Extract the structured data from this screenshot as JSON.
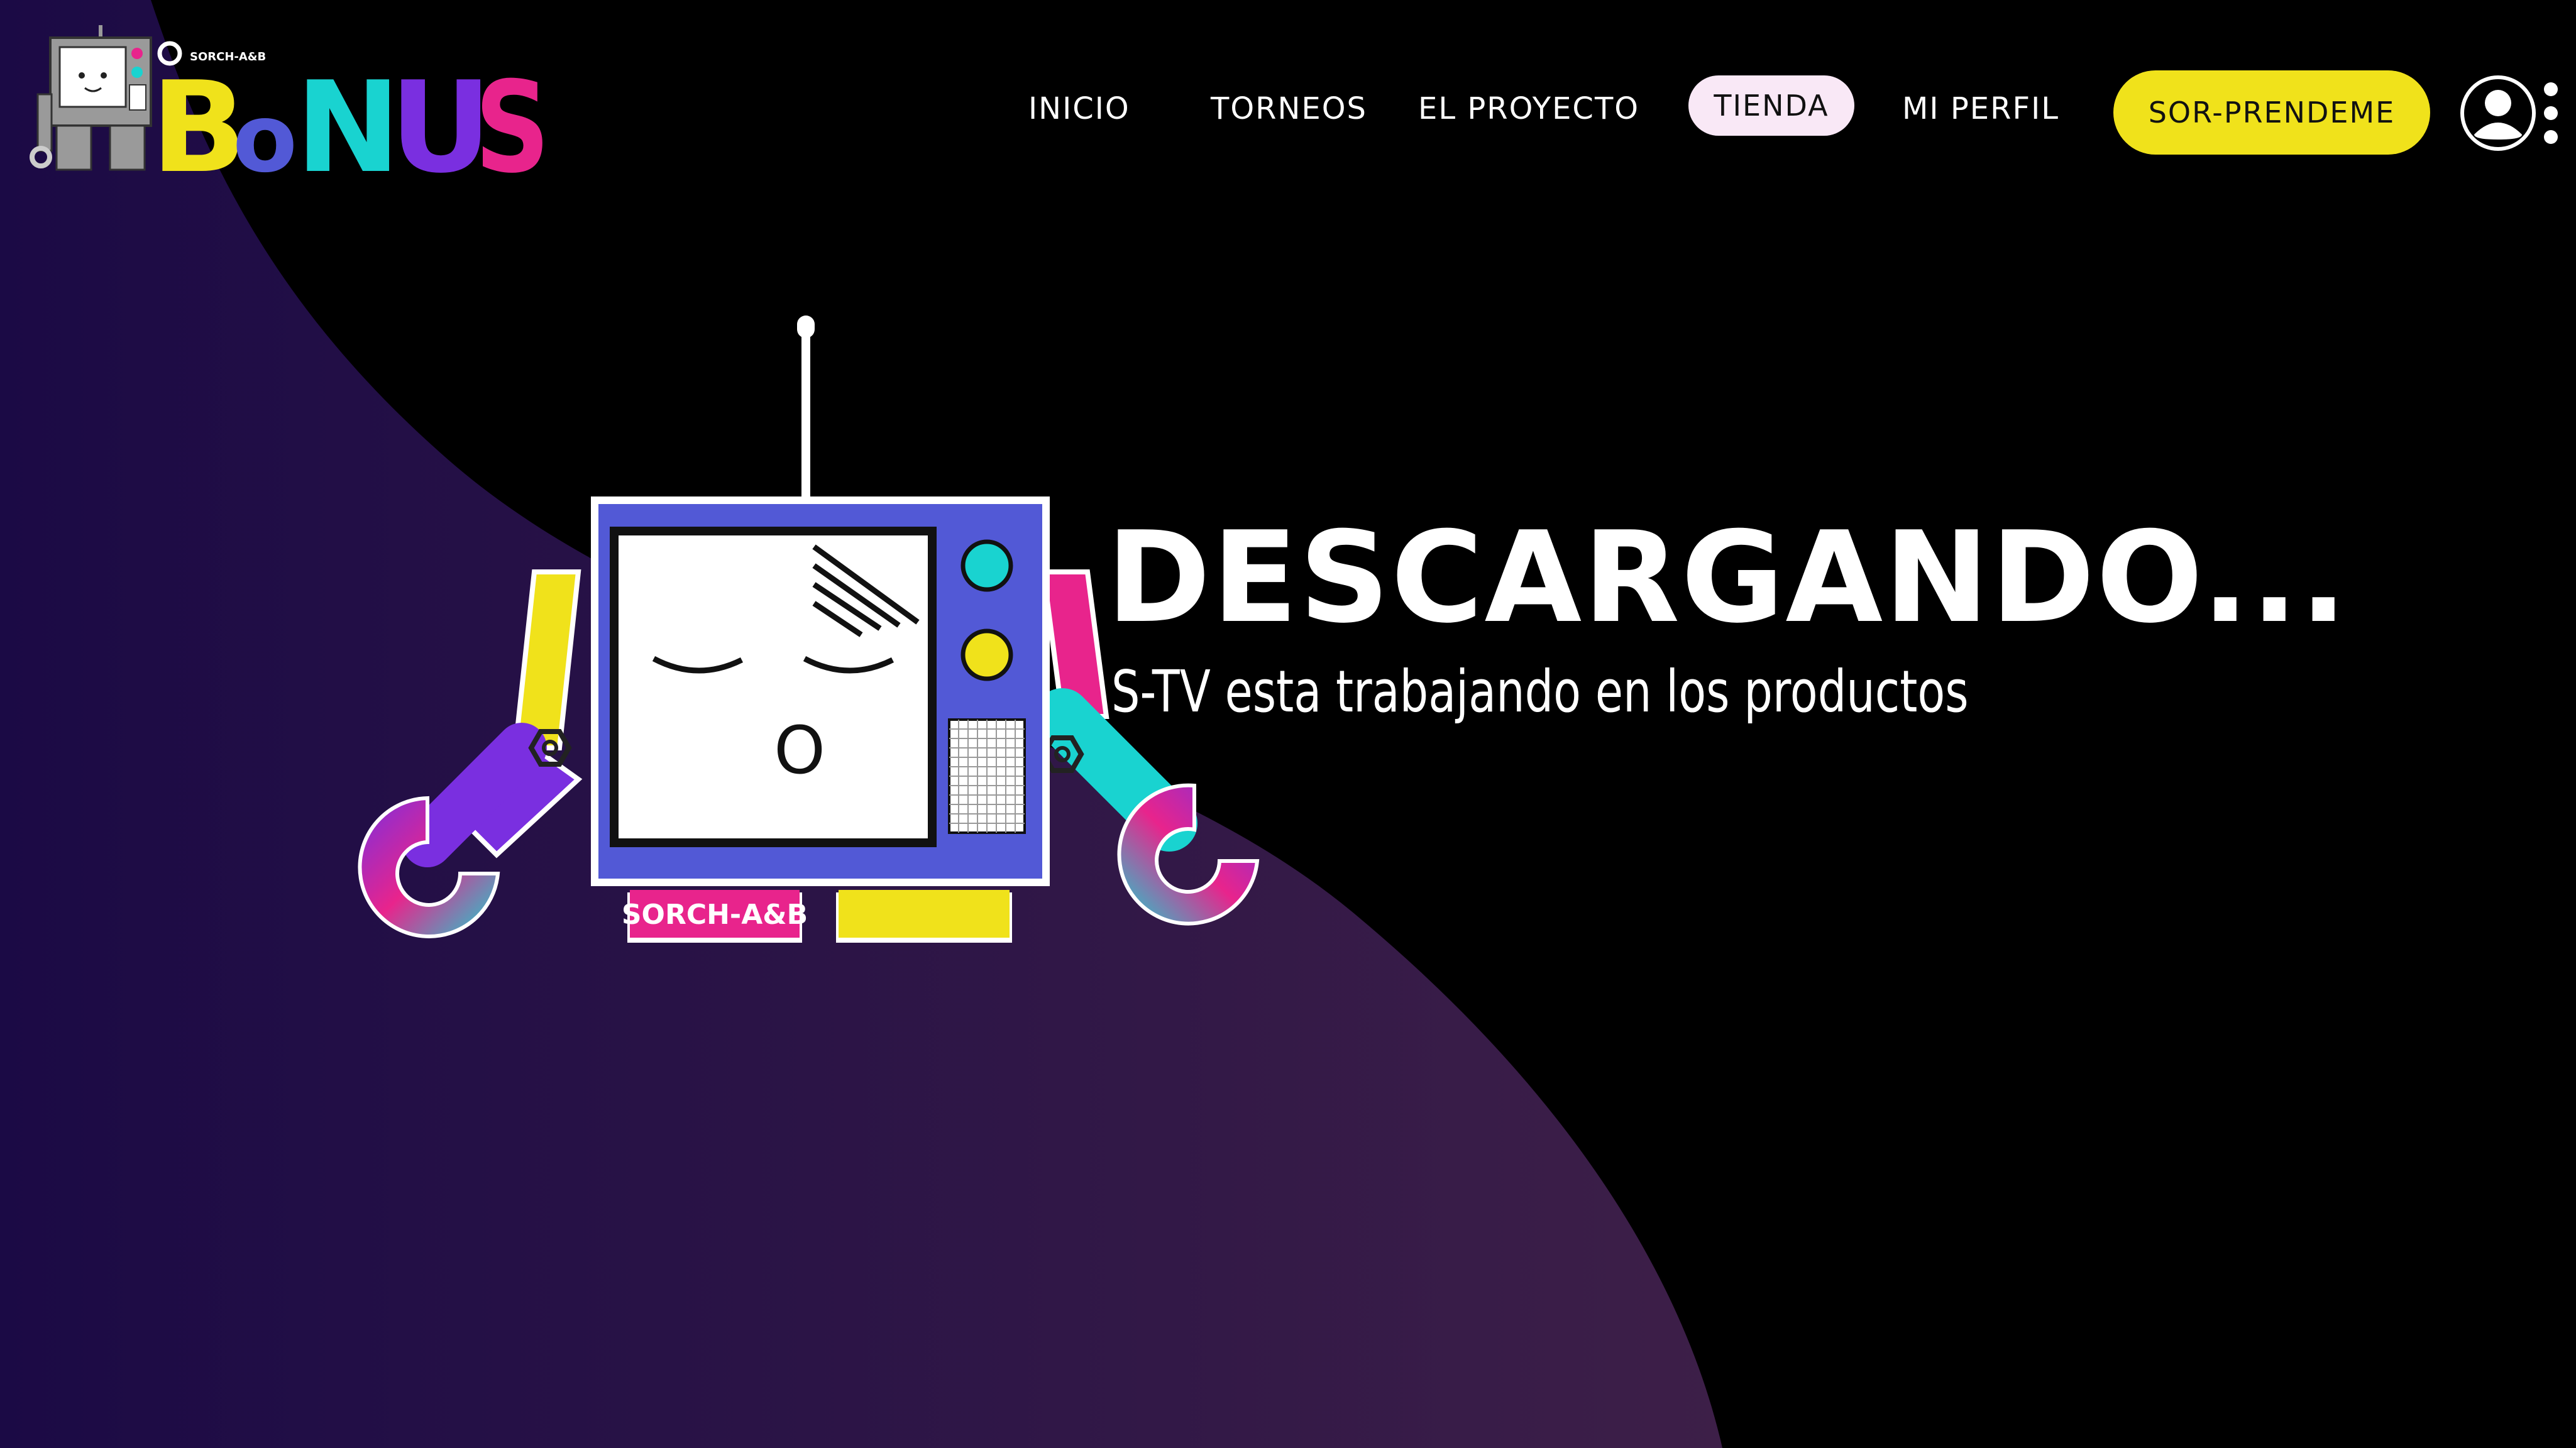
{
  "logo": {
    "brand_text": "BoNUS",
    "tag_text": "SORCH-A&B"
  },
  "nav": {
    "items": [
      {
        "label": "INICIO"
      },
      {
        "label": "TORNEOS"
      },
      {
        "label": "EL PROYECTO"
      },
      {
        "label": "TIENDA",
        "active": true
      },
      {
        "label": "MI PERFIL"
      }
    ],
    "cta_label": "SOR-PRENDEME",
    "user_icon": "user-circle-icon",
    "menu_icon": "kebab-menu-icon"
  },
  "mascot": {
    "badge_text": "SORCH-A&B",
    "mouth_text": "O"
  },
  "hero": {
    "title": "DESCARGANDO...",
    "subtitle": "S-TV esta trabajando en los productos"
  },
  "colors": {
    "background": "#000000",
    "purple_blob_start": "#1b0a45",
    "purple_blob_end": "#3d1f48",
    "accent_yellow": "#f0e21b",
    "accent_pink": "#e8248c",
    "accent_cyan": "#19d3d0",
    "accent_purple": "#7a2fe0",
    "tv_blue": "#5259d6",
    "tienda_pill": "#f9e8f6"
  }
}
